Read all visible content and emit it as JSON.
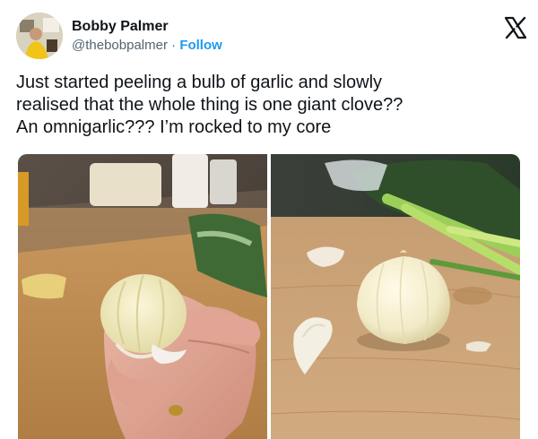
{
  "author": {
    "name": "Bobby Palmer",
    "handle": "@thebobpalmer",
    "separator": " · ",
    "follow_label": "Follow"
  },
  "icons": {
    "platform_logo": "x-logo-icon",
    "avatar": "avatar-image"
  },
  "tweet": {
    "text": "Just started peeling a bulb of garlic and slowly\nrealised that the whole thing is one giant clove??\nAn omnigarlic??? I’m rocked to my core"
  },
  "colors": {
    "follow": "#1d9bf0",
    "text": "#0f1419",
    "secondary": "#536471"
  }
}
